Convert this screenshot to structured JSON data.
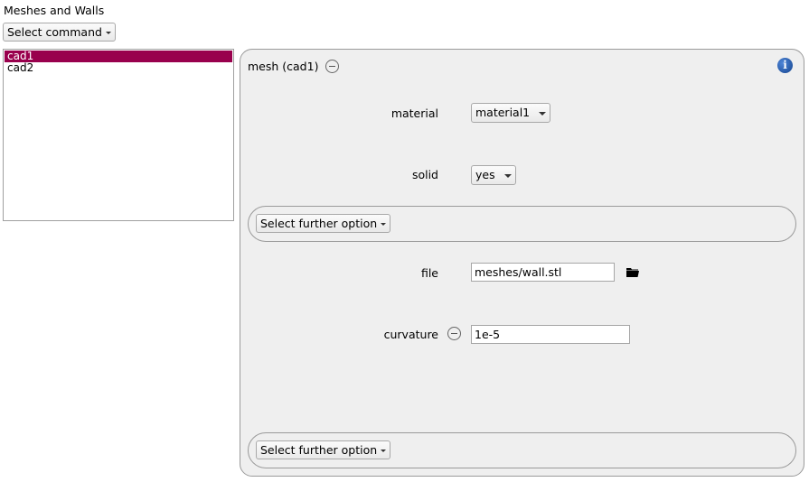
{
  "section": {
    "title": "Meshes and Walls"
  },
  "command_select": {
    "label": "Select command"
  },
  "list": {
    "items": [
      {
        "label": "cad1",
        "selected": true
      },
      {
        "label": "cad2",
        "selected": false
      }
    ]
  },
  "panel": {
    "title": "mesh (cad1)",
    "material": {
      "label": "material",
      "value": "material1"
    },
    "solid": {
      "label": "solid",
      "value": "yes"
    },
    "further_option_1": {
      "label": "Select further option"
    },
    "file": {
      "label": "file",
      "value": "meshes/wall.stl"
    },
    "curvature": {
      "label": "curvature",
      "value": "1e-5"
    },
    "further_option_2": {
      "label": "Select further option"
    }
  },
  "colors": {
    "selection": "#99004d",
    "info": "#1f5bb5"
  },
  "icons": [
    "remove-circle-icon",
    "info-icon",
    "folder-icon",
    "chevron-down-icon"
  ]
}
